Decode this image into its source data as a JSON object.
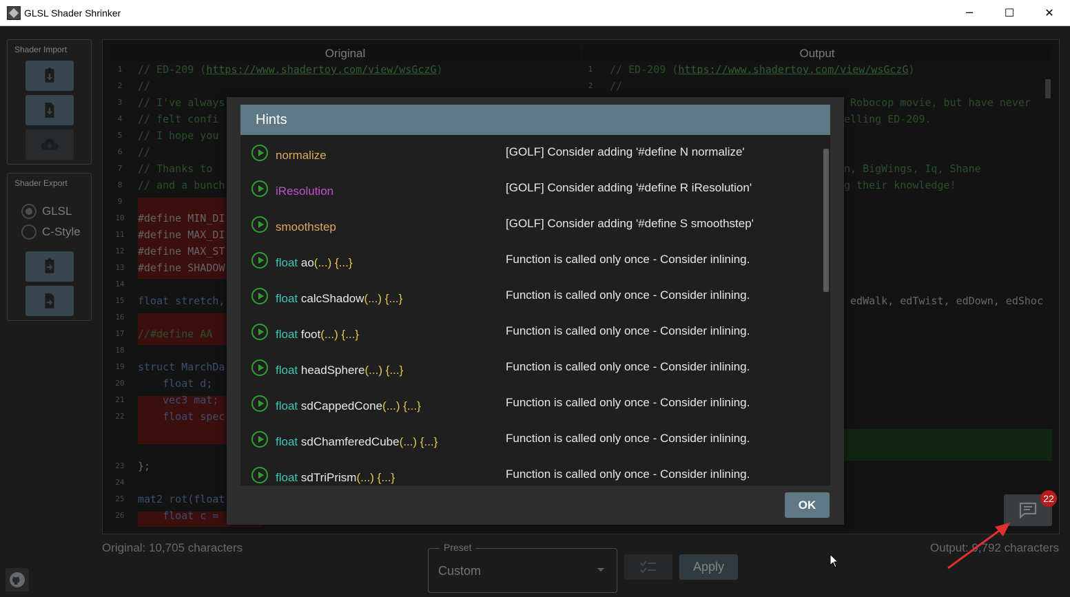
{
  "window": {
    "title": "GLSL Shader Shrinker",
    "minimize": "─",
    "maximize": "☐",
    "close": "✕"
  },
  "sidebar": {
    "import_label": "Shader Import",
    "export_label": "Shader Export",
    "radio_options": [
      "GLSL",
      "C-Style"
    ],
    "selected": "GLSL"
  },
  "editor": {
    "original_title": "Original",
    "output_title": "Output",
    "original_lines": [
      {
        "n": "1",
        "t": "// ED-209 ("
      },
      {
        "n": "2",
        "t": "//"
      },
      {
        "n": "3",
        "t": "// I've always"
      },
      {
        "n": "4",
        "t": "// felt confi"
      },
      {
        "n": "5",
        "t": "// I hope you"
      },
      {
        "n": "6",
        "t": "//"
      },
      {
        "n": "7",
        "t": "// Thanks to "
      },
      {
        "n": "8",
        "t": "// and a bunch"
      },
      {
        "n": "9",
        "t": ""
      },
      {
        "n": "10",
        "t": "#define MIN_DI"
      },
      {
        "n": "11",
        "t": "#define MAX_DI"
      },
      {
        "n": "12",
        "t": "#define MAX_ST"
      },
      {
        "n": "13",
        "t": "#define SHADOW"
      },
      {
        "n": "14",
        "t": ""
      },
      {
        "n": "15",
        "t": "float stretch,"
      },
      {
        "n": "16",
        "t": ""
      },
      {
        "n": "17",
        "t": "//#define AA"
      },
      {
        "n": "18",
        "t": ""
      },
      {
        "n": "19",
        "t": "struct MarchDa"
      },
      {
        "n": "20",
        "t": "    float d;"
      },
      {
        "n": "21",
        "t": "    vec3 mat;"
      },
      {
        "n": "22",
        "t": "    float spec"
      },
      {
        "n": "23",
        "t": "};"
      },
      {
        "n": "24",
        "t": ""
      },
      {
        "n": "25",
        "t": "mat2 rot(float"
      },
      {
        "n": "26",
        "t": "    float c = "
      }
    ],
    "link": "https://www.shadertoy.com/view/wsGczG",
    "link_close": ")",
    "output_lines": [
      {
        "n": "1",
        "t": "// ED-209 ("
      },
      {
        "n": "2",
        "t": "//"
      }
    ],
    "output_fragments": [
      " Robocop movie, but have never",
      "elling ED-209.",
      "n, BigWings, Iq, Shane",
      "g their knowledge!",
      " edWalk, edTwist, edDown, edShoc"
    ]
  },
  "status": {
    "original": "Original: 10,705 characters",
    "output": "Output: 9,792 characters"
  },
  "preset": {
    "label": "Preset",
    "value": "Custom"
  },
  "buttons": {
    "apply": "Apply",
    "ok": "OK"
  },
  "hints_badge": "22",
  "dialog": {
    "title": "Hints",
    "hints": [
      {
        "type": "",
        "name": "normalize",
        "suffix": "",
        "name_color": "#e0a85a",
        "desc": "[GOLF] Consider adding '#define N normalize'"
      },
      {
        "type": "",
        "name": "iResolution",
        "suffix": "",
        "name_color": "#c050d0",
        "desc": "[GOLF] Consider adding '#define R iResolution'"
      },
      {
        "type": "",
        "name": "smoothstep",
        "suffix": "",
        "name_color": "#e0a85a",
        "desc": "[GOLF] Consider adding '#define S smoothstep'"
      },
      {
        "type": "float",
        "name": "ao",
        "suffix": "(...) {...}",
        "name_color": "#e8e8e8",
        "desc": "Function is called only once - Consider inlining."
      },
      {
        "type": "float",
        "name": "calcShadow",
        "suffix": "(...) {...}",
        "name_color": "#e8e8e8",
        "desc": "Function is called only once - Consider inlining."
      },
      {
        "type": "float",
        "name": "foot",
        "suffix": "(...) {...}",
        "name_color": "#e8e8e8",
        "desc": "Function is called only once - Consider inlining."
      },
      {
        "type": "float",
        "name": "headSphere",
        "suffix": "(...) {...}",
        "name_color": "#e8e8e8",
        "desc": "Function is called only once - Consider inlining."
      },
      {
        "type": "float",
        "name": "sdCappedCone",
        "suffix": "(...) {...}",
        "name_color": "#e8e8e8",
        "desc": "Function is called only once - Consider inlining."
      },
      {
        "type": "float",
        "name": "sdChamferedCube",
        "suffix": "(...) {...}",
        "name_color": "#e8e8e8",
        "desc": "Function is called only once - Consider inlining."
      },
      {
        "type": "float",
        "name": "sdTriPrism",
        "suffix": "(...) {...}",
        "name_color": "#e8e8e8",
        "desc": "Function is called only once - Consider inlining."
      }
    ]
  },
  "colors": {
    "accent": "#5f7886",
    "play_green": "#2fa02f",
    "badge_red": "#b71c1c",
    "type_color": "#3ec8b4",
    "suffix_color": "#e6c84a"
  }
}
